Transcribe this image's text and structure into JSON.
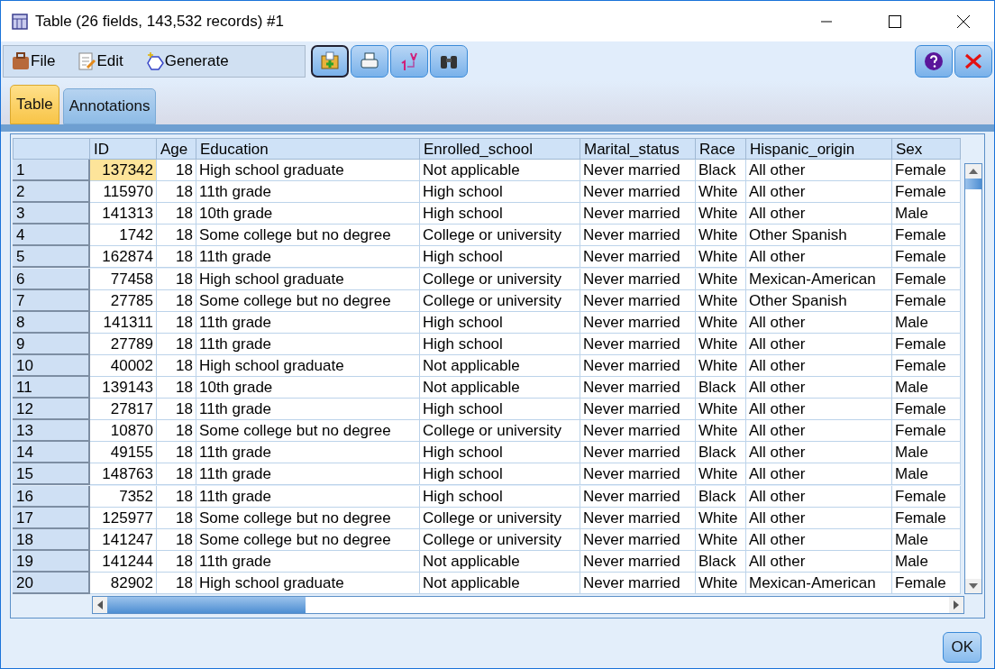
{
  "window": {
    "title": "Table (26 fields, 143,532 records) #1"
  },
  "menu": [
    {
      "label": "File",
      "kind": "file"
    },
    {
      "label": "Edit",
      "kind": "edit"
    },
    {
      "label": "Generate",
      "kind": "generate"
    }
  ],
  "tabs": [
    {
      "label": "Table",
      "selected": true
    },
    {
      "label": "Annotations",
      "selected": false
    }
  ],
  "table": {
    "columns": [
      {
        "label": "ID",
        "kind": "number"
      },
      {
        "label": "Age",
        "kind": "number"
      },
      {
        "label": "Education",
        "kind": "text"
      },
      {
        "label": "Enrolled_school",
        "kind": "text"
      },
      {
        "label": "Marital_status",
        "kind": "text"
      },
      {
        "label": "Race",
        "kind": "text"
      },
      {
        "label": "Hispanic_origin",
        "kind": "text"
      },
      {
        "label": "Sex",
        "kind": "text"
      }
    ],
    "rows": [
      {
        "label": "1",
        "id_cell_selected": true,
        "cells": [
          "137342",
          "18",
          "High school graduate",
          "Not applicable",
          "Never married",
          "Black",
          "All other",
          "Female"
        ]
      },
      {
        "label": "2",
        "id_cell_selected": false,
        "cells": [
          "115970",
          "18",
          "11th grade",
          "High school",
          "Never married",
          "White",
          "All other",
          "Female"
        ]
      },
      {
        "label": "3",
        "id_cell_selected": false,
        "cells": [
          "141313",
          "18",
          "10th grade",
          "High school",
          "Never married",
          "White",
          "All other",
          "Male"
        ]
      },
      {
        "label": "4",
        "id_cell_selected": false,
        "cells": [
          "1742",
          "18",
          "Some college but no degree",
          "College or university",
          "Never married",
          "White",
          "Other Spanish",
          "Female"
        ]
      },
      {
        "label": "5",
        "id_cell_selected": false,
        "cells": [
          "162874",
          "18",
          "11th grade",
          "High school",
          "Never married",
          "White",
          "All other",
          "Female"
        ]
      },
      {
        "label": "6",
        "id_cell_selected": false,
        "cells": [
          "77458",
          "18",
          "High school graduate",
          "College or university",
          "Never married",
          "White",
          "Mexican-American",
          "Female"
        ]
      },
      {
        "label": "7",
        "id_cell_selected": false,
        "cells": [
          "27785",
          "18",
          "Some college but no degree",
          "College or university",
          "Never married",
          "White",
          "Other Spanish",
          "Female"
        ]
      },
      {
        "label": "8",
        "id_cell_selected": false,
        "cells": [
          "141311",
          "18",
          "11th grade",
          "High school",
          "Never married",
          "White",
          "All other",
          "Male"
        ]
      },
      {
        "label": "9",
        "id_cell_selected": false,
        "cells": [
          "27789",
          "18",
          "11th grade",
          "High school",
          "Never married",
          "White",
          "All other",
          "Female"
        ]
      },
      {
        "label": "10",
        "id_cell_selected": false,
        "cells": [
          "40002",
          "18",
          "High school graduate",
          "Not applicable",
          "Never married",
          "White",
          "All other",
          "Female"
        ]
      },
      {
        "label": "11",
        "id_cell_selected": false,
        "cells": [
          "139143",
          "18",
          "10th grade",
          "Not applicable",
          "Never married",
          "Black",
          "All other",
          "Male"
        ]
      },
      {
        "label": "12",
        "id_cell_selected": false,
        "cells": [
          "27817",
          "18",
          "11th grade",
          "High school",
          "Never married",
          "White",
          "All other",
          "Female"
        ]
      },
      {
        "label": "13",
        "id_cell_selected": false,
        "cells": [
          "10870",
          "18",
          "Some college but no degree",
          "College or university",
          "Never married",
          "White",
          "All other",
          "Female"
        ]
      },
      {
        "label": "14",
        "id_cell_selected": false,
        "cells": [
          "49155",
          "18",
          "11th grade",
          "High school",
          "Never married",
          "Black",
          "All other",
          "Male"
        ]
      },
      {
        "label": "15",
        "id_cell_selected": false,
        "cells": [
          "148763",
          "18",
          "11th grade",
          "High school",
          "Never married",
          "White",
          "All other",
          "Male"
        ]
      },
      {
        "label": "16",
        "id_cell_selected": false,
        "cells": [
          "7352",
          "18",
          "11th grade",
          "High school",
          "Never married",
          "Black",
          "All other",
          "Female"
        ]
      },
      {
        "label": "17",
        "id_cell_selected": false,
        "cells": [
          "125977",
          "18",
          "Some college but no degree",
          "College or university",
          "Never married",
          "White",
          "All other",
          "Female"
        ]
      },
      {
        "label": "18",
        "id_cell_selected": false,
        "cells": [
          "141247",
          "18",
          "Some college but no degree",
          "College or university",
          "Never married",
          "White",
          "All other",
          "Male"
        ]
      },
      {
        "label": "19",
        "id_cell_selected": false,
        "cells": [
          "141244",
          "18",
          "11th grade",
          "Not applicable",
          "Never married",
          "Black",
          "All other",
          "Male"
        ]
      },
      {
        "label": "20",
        "id_cell_selected": false,
        "cells": [
          "82902",
          "18",
          "High school graduate",
          "Not applicable",
          "Never married",
          "White",
          "Mexican-American",
          "Female"
        ]
      }
    ]
  },
  "buttons": [
    {
      "label": "OK"
    }
  ]
}
